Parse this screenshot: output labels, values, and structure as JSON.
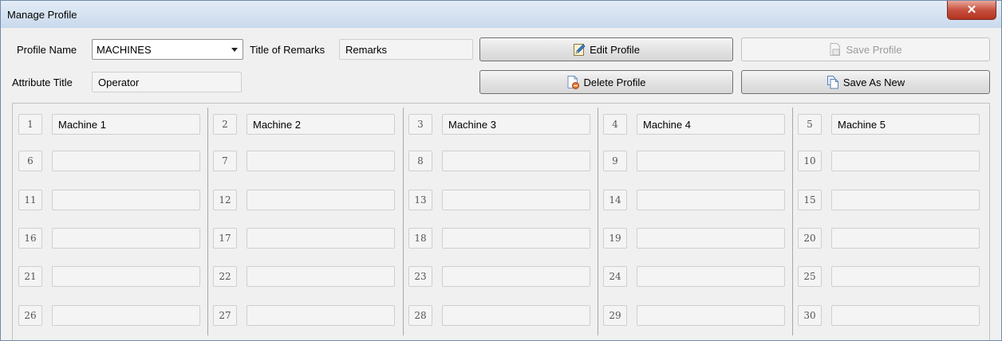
{
  "window": {
    "title": "Manage Profile",
    "close_symbol": "✕"
  },
  "form": {
    "profile_name_label": "Profile Name",
    "profile_name_value": "MACHINES",
    "remarks_title_label": "Title of Remarks",
    "remarks_title_value": "Remarks",
    "attribute_title_label": "Attribute Title",
    "attribute_title_value": "Operator"
  },
  "buttons": {
    "edit_profile": "Edit Profile",
    "save_profile": "Save Profile",
    "delete_profile": "Delete Profile",
    "save_as_new": "Save As New"
  },
  "attributes": [
    {
      "number": "1",
      "value": "Machine 1"
    },
    {
      "number": "2",
      "value": "Machine 2"
    },
    {
      "number": "3",
      "value": "Machine 3"
    },
    {
      "number": "4",
      "value": "Machine 4"
    },
    {
      "number": "5",
      "value": "Machine 5"
    },
    {
      "number": "6",
      "value": ""
    },
    {
      "number": "7",
      "value": ""
    },
    {
      "number": "8",
      "value": ""
    },
    {
      "number": "9",
      "value": ""
    },
    {
      "number": "10",
      "value": ""
    },
    {
      "number": "11",
      "value": ""
    },
    {
      "number": "12",
      "value": ""
    },
    {
      "number": "13",
      "value": ""
    },
    {
      "number": "14",
      "value": ""
    },
    {
      "number": "15",
      "value": ""
    },
    {
      "number": "16",
      "value": ""
    },
    {
      "number": "17",
      "value": ""
    },
    {
      "number": "18",
      "value": ""
    },
    {
      "number": "19",
      "value": ""
    },
    {
      "number": "20",
      "value": ""
    },
    {
      "number": "21",
      "value": ""
    },
    {
      "number": "22",
      "value": ""
    },
    {
      "number": "23",
      "value": ""
    },
    {
      "number": "24",
      "value": ""
    },
    {
      "number": "25",
      "value": ""
    },
    {
      "number": "26",
      "value": ""
    },
    {
      "number": "27",
      "value": ""
    },
    {
      "number": "28",
      "value": ""
    },
    {
      "number": "29",
      "value": ""
    },
    {
      "number": "30",
      "value": ""
    }
  ]
}
